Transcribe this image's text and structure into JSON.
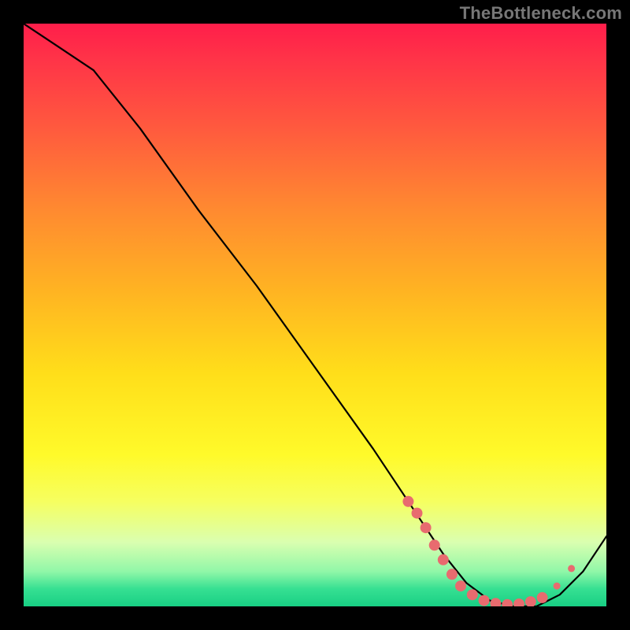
{
  "watermark": "TheBottleneck.com",
  "chart_data": {
    "type": "line",
    "title": "",
    "xlabel": "",
    "ylabel": "",
    "xlim": [
      0,
      100
    ],
    "ylim": [
      0,
      100
    ],
    "grid": false,
    "series": [
      {
        "name": "curve",
        "x": [
          0,
          6,
          12,
          20,
          30,
          40,
          50,
          60,
          66,
          72,
          76,
          80,
          84,
          88,
          92,
          96,
          100
        ],
        "y": [
          100,
          96,
          92,
          82,
          68,
          55,
          41,
          27,
          18,
          9,
          4,
          1,
          0,
          0,
          2,
          6,
          12
        ]
      }
    ],
    "markers": [
      {
        "x": 66,
        "y": 18
      },
      {
        "x": 67.5,
        "y": 16
      },
      {
        "x": 69,
        "y": 13.5
      },
      {
        "x": 70.5,
        "y": 10.5
      },
      {
        "x": 72,
        "y": 8
      },
      {
        "x": 73.5,
        "y": 5.5
      },
      {
        "x": 75,
        "y": 3.5
      },
      {
        "x": 77,
        "y": 2
      },
      {
        "x": 79,
        "y": 1
      },
      {
        "x": 81,
        "y": 0.5
      },
      {
        "x": 83,
        "y": 0.3
      },
      {
        "x": 85,
        "y": 0.4
      },
      {
        "x": 87,
        "y": 0.8
      },
      {
        "x": 89,
        "y": 1.5
      },
      {
        "x": 91.5,
        "y": 3.5
      },
      {
        "x": 94,
        "y": 6.5
      }
    ],
    "background_gradient": {
      "top": "#ff1e4a",
      "mid": "#ffe01a",
      "bottom": "#18cf84"
    }
  }
}
